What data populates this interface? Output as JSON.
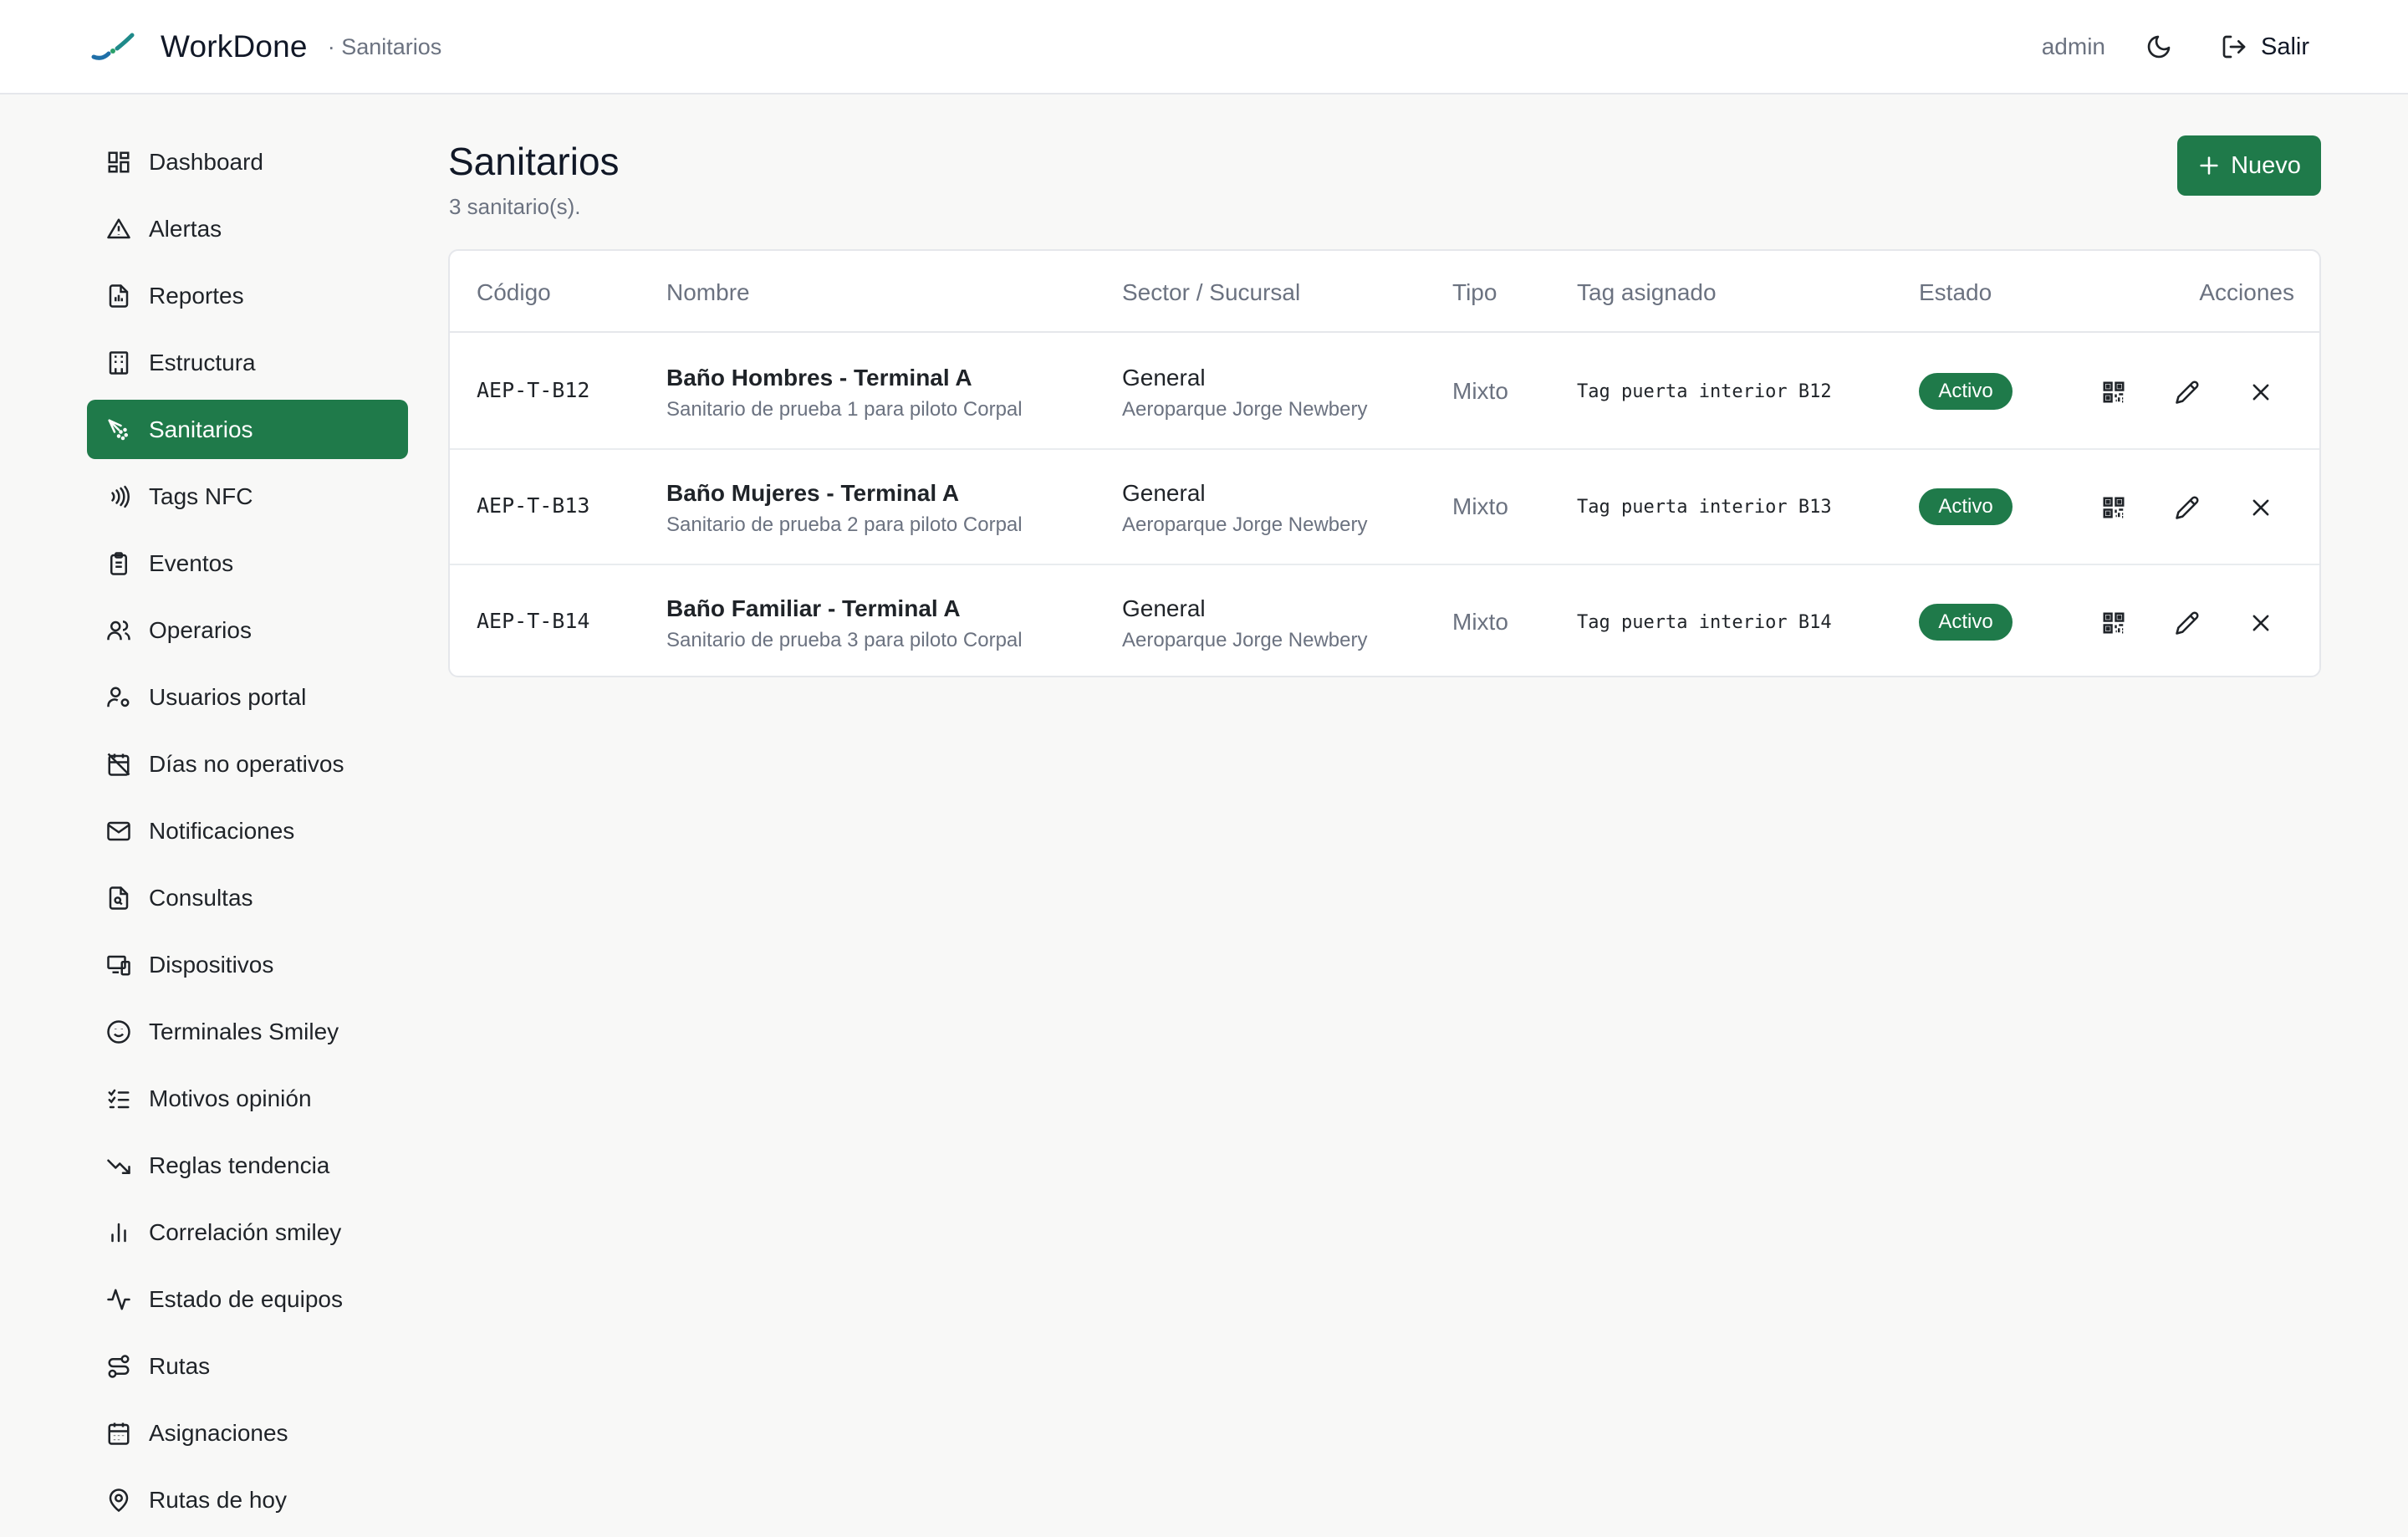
{
  "app": {
    "name": "WorkDone",
    "section": "· Sanitarios"
  },
  "topbar": {
    "user": "admin",
    "logout_label": "Salir"
  },
  "colors": {
    "accent": "#1f7a4a",
    "muted": "#6b7280"
  },
  "sidebar": {
    "items": [
      {
        "label": "Dashboard",
        "icon": "dashboard-icon"
      },
      {
        "label": "Alertas",
        "icon": "alert-triangle-icon"
      },
      {
        "label": "Reportes",
        "icon": "report-file-icon"
      },
      {
        "label": "Estructura",
        "icon": "building-icon"
      },
      {
        "label": "Sanitarios",
        "icon": "spray-icon",
        "active": true
      },
      {
        "label": "Tags NFC",
        "icon": "nfc-icon"
      },
      {
        "label": "Eventos",
        "icon": "clipboard-icon"
      },
      {
        "label": "Operarios",
        "icon": "users-icon"
      },
      {
        "label": "Usuarios portal",
        "icon": "user-cog-icon"
      },
      {
        "label": "Días no operativos",
        "icon": "calendar-off-icon"
      },
      {
        "label": "Notificaciones",
        "icon": "mail-icon"
      },
      {
        "label": "Consultas",
        "icon": "file-search-icon"
      },
      {
        "label": "Dispositivos",
        "icon": "devices-icon"
      },
      {
        "label": "Terminales Smiley",
        "icon": "smiley-icon"
      },
      {
        "label": "Motivos opinión",
        "icon": "list-checks-icon"
      },
      {
        "label": "Reglas tendencia",
        "icon": "trending-down-icon"
      },
      {
        "label": "Correlación smiley",
        "icon": "bar-chart-icon"
      },
      {
        "label": "Estado de equipos",
        "icon": "activity-icon"
      },
      {
        "label": "Rutas",
        "icon": "route-icon"
      },
      {
        "label": "Asignaciones",
        "icon": "calendar-icon"
      },
      {
        "label": "Rutas de hoy",
        "icon": "map-pin-icon"
      }
    ]
  },
  "main": {
    "title": "Sanitarios",
    "subtitle": "3 sanitario(s).",
    "new_button": "Nuevo",
    "columns": [
      "Código",
      "Nombre",
      "Sector / Sucursal",
      "Tipo",
      "Tag asignado",
      "Estado",
      "Acciones"
    ],
    "rows": [
      {
        "code": "AEP-T-B12",
        "name": "Baño Hombres - Terminal A",
        "desc": "Sanitario de prueba 1 para piloto Corpal",
        "sector": "General",
        "branch": "Aeroparque Jorge Newbery",
        "tipo": "Mixto",
        "tag": "Tag puerta interior B12",
        "estado": "Activo"
      },
      {
        "code": "AEP-T-B13",
        "name": "Baño Mujeres - Terminal A",
        "desc": "Sanitario de prueba 2 para piloto Corpal",
        "sector": "General",
        "branch": "Aeroparque Jorge Newbery",
        "tipo": "Mixto",
        "tag": "Tag puerta interior B13",
        "estado": "Activo"
      },
      {
        "code": "AEP-T-B14",
        "name": "Baño Familiar - Terminal A",
        "desc": "Sanitario de prueba 3 para piloto Corpal",
        "sector": "General",
        "branch": "Aeroparque Jorge Newbery",
        "tipo": "Mixto",
        "tag": "Tag puerta interior B14",
        "estado": "Activo"
      }
    ]
  }
}
